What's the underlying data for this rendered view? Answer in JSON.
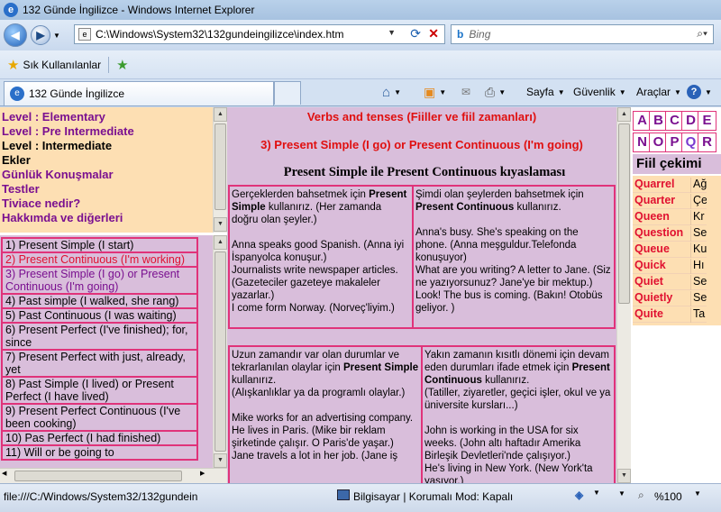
{
  "window": {
    "title": "132 Günde İngilizce - Windows Internet Explorer"
  },
  "address": {
    "url": "C:\\Windows\\System32\\132gundeingilizce\\index.htm",
    "search_placeholder": "Bing"
  },
  "favorites": {
    "label": "Sık Kullanılanlar"
  },
  "tab": {
    "label": "132 Günde İngilizce"
  },
  "commands": {
    "page": "Sayfa",
    "security": "Güvenlik",
    "tools": "Araçlar"
  },
  "left_frame": {
    "levels": [
      "Level : Elementary",
      "Level : Pre Intermediate",
      "Level : Intermediate",
      "Ekler",
      "Günlük Konuşmalar",
      "Testler",
      "Tiviace nedir?",
      "Hakkımda ve diğerleri"
    ],
    "lessons": [
      "1) Present Simple (I start)",
      "2) Present Continuous (I'm working)",
      "3) Present Simple (I go) or Present Continuous (I'm going)",
      "4) Past simple (I walked, she rang)",
      "5) Past Continuous (I was waiting)",
      "6) Present Perfect (I've finished); for, since",
      "7) Present Perfect with just, already, yet",
      "8) Past Simple (I lived) or Present Perfect (I have lived)",
      "9) Present Perfect Continuous (I've been cooking)",
      "10) Pas Perfect (I had finished)",
      "11) Will or be going to"
    ]
  },
  "main": {
    "title": "Verbs and tenses (Fiiller ve fiil zamanları)",
    "subtitle": "3) Present Simple (I go) or Present Continuous (I'm going)",
    "heading": "Present Simple ile Present Continuous kıyaslaması",
    "box1": {
      "intro_a": "Gerçeklerden bahsetmek için ",
      "bold": "Present Simple",
      "intro_b": " kullanırız. (Her zamanda doğru olan şeyler.)",
      "lines": [
        "Anna speaks good Spanish. (Anna iyi İspanyolca konuşur.)",
        "Journalists write newspaper articles. (Gazeteciler gazeteye makaleler yazarlar.)",
        "I come form Norway. (Norveç'liyim.)"
      ]
    },
    "box2": {
      "intro_a": "Şimdi olan şeylerden bahsetmek için ",
      "bold": "Present Continuous",
      "intro_b": " kullanırız.",
      "lines": [
        "Anna's busy. She's speaking on the phone. (Anna meşguldur.Telefonda konuşuyor)",
        "What are you writing? A letter to Jane. (Siz ne yazıyorsunuz? Jane'ye bir mektup.)",
        "Look! The bus is coming. (Bakın! Otobüs geliyor. )"
      ]
    },
    "box3": {
      "intro_a": "Uzun zamandır var olan durumlar ve tekrarlanılan olaylar için ",
      "bold": "Present Simple",
      "intro_b": " kullanırız.",
      "paren": "(Alışkanlıklar ya da programlı olaylar.)",
      "lines": [
        "Mike works for an advertising company. He lives in Paris. (Mike bir reklam şirketinde çalışır. O Paris'de yaşar.)",
        "Jane travels a lot in her job. (Jane iş"
      ]
    },
    "box4": {
      "intro_a": "Yakın zamanın kısıtlı dönemi için devam eden durumları ifade etmek için ",
      "bold": "Present Continuous",
      "intro_b": " kullanırız.",
      "paren": "(Tatiller, ziyaretler, geçici işler, okul ve ya üniversite kursları...)",
      "lines": [
        "John is working in the USA for six weeks. (John altı haftadır Amerika Birleşik Devletleri'nde çalışıyor.)",
        "He's living in New York. (New York'ta yaşıyor.)"
      ]
    }
  },
  "right_frame": {
    "row1": [
      "A",
      "B",
      "C",
      "D",
      "E"
    ],
    "row2": [
      "N",
      "O",
      "P",
      "Q",
      "R"
    ],
    "header": "Fiil çekimi",
    "words": [
      {
        "w": "Quarrel",
        "d": "Ağ"
      },
      {
        "w": "Quarter",
        "d": "Çe"
      },
      {
        "w": "Queen",
        "d": "Kr"
      },
      {
        "w": "Question",
        "d": "Se"
      },
      {
        "w": "Queue",
        "d": "Ku"
      },
      {
        "w": "Quick",
        "d": "Hı"
      },
      {
        "w": "Quiet",
        "d": "Se"
      },
      {
        "w": "Quietly",
        "d": "Se"
      },
      {
        "w": "Quite",
        "d": "Ta"
      }
    ]
  },
  "status": {
    "path": "file:///C:/Windows/System32/132gundein",
    "zone": "Bilgisayar | Korumalı Mod: Kapalı",
    "zoom": "%100"
  }
}
